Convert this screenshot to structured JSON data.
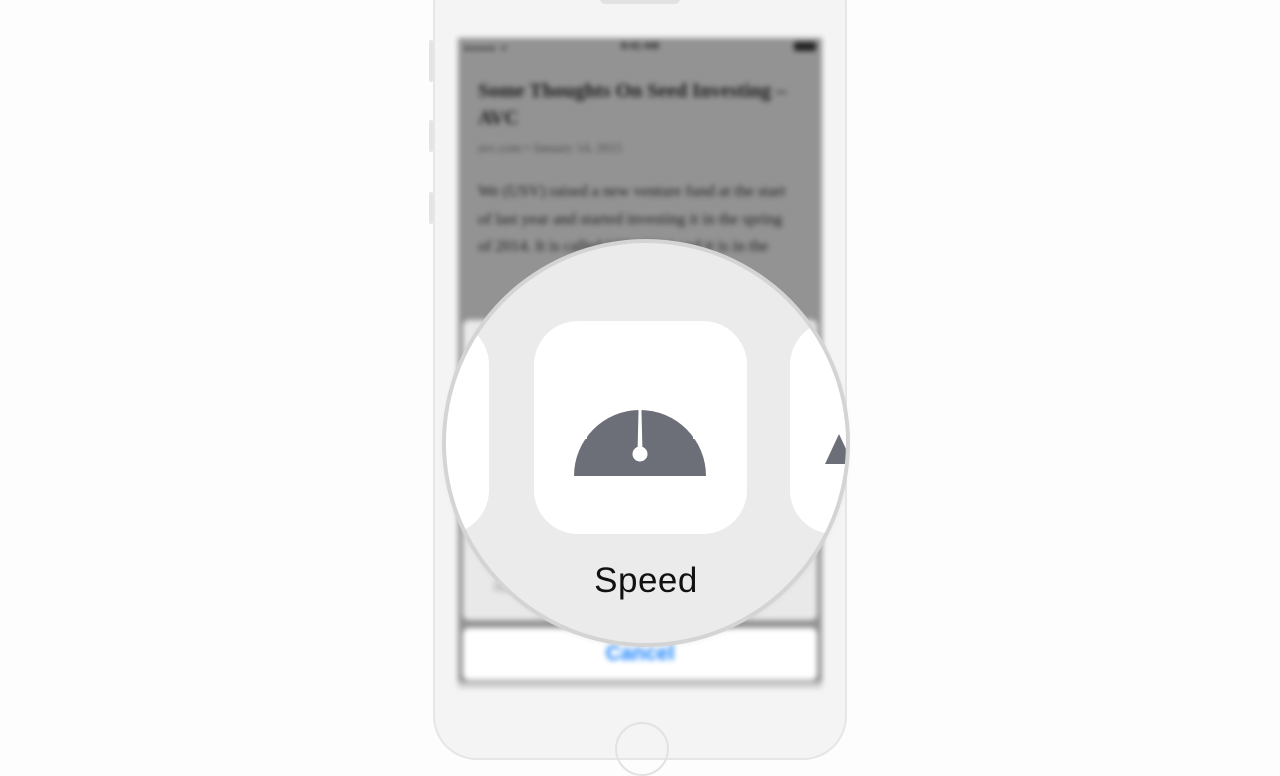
{
  "status_bar": {
    "signal": "●●●●● ᯤ",
    "time": "8:41 AM"
  },
  "article": {
    "title": "Some Thoughts On Seed Investing – AVC",
    "meta": "avc.com • January 14, 2015",
    "body": "We (USV) raised a new venture fund at the start of last year and started investing it in the spring of 2014. It is called USV 2014 and it is in the"
  },
  "share_sheet": {
    "cancel_label": "Cancel"
  },
  "magnifier": {
    "selected_action": {
      "label": "Speed",
      "icon": "speedometer-icon"
    },
    "icon_color": "#6d6f78"
  },
  "colors": {
    "cancel_blue": "#1a82fb",
    "screen_dim": "#939393",
    "sheet_bg": "#e9e9e9"
  }
}
